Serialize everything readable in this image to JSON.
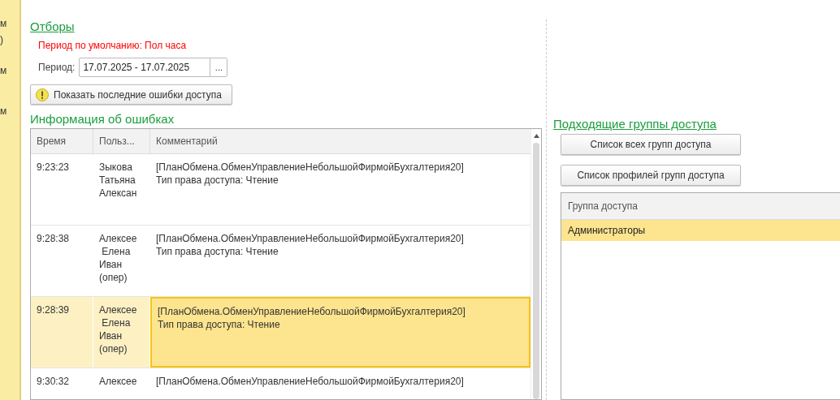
{
  "sidebar": {
    "items": [
      {
        "text": "м"
      },
      {
        "text": ")"
      },
      {
        "text": "м"
      },
      {
        "text": "м"
      }
    ]
  },
  "filters": {
    "title": "Отборы",
    "default_period_note": "Период по умолчанию: Пол часа",
    "period_label": "Период:",
    "period_value": "17.07.2025 - 17.07.2025",
    "period_button": "...",
    "show_errors_button": "Показать последние ошибки доступа"
  },
  "errors": {
    "title": "Информация об ошибках",
    "columns": [
      "Время",
      "Польз...",
      "Комментарий"
    ],
    "rows": [
      {
        "time": "9:23:23",
        "user": [
          "Зыкова",
          "Татьяна",
          "Алексан"
        ],
        "comment": [
          "[ПланОбмена.ОбменУправлениеНебольшойФирмойБухгалтерия20]",
          "Тип права доступа: Чтение"
        ],
        "selected": false
      },
      {
        "time": "9:28:38",
        "user": [
          "Алексее",
          " Елена",
          "Иван",
          "(опер)"
        ],
        "comment": [
          "[ПланОбмена.ОбменУправлениеНебольшойФирмойБухгалтерия20]",
          "Тип права доступа: Чтение"
        ],
        "selected": false
      },
      {
        "time": "9:28:39",
        "user": [
          "Алексее",
          " Елена",
          "Иван",
          "(опер)"
        ],
        "comment": [
          "[ПланОбмена.ОбменУправлениеНебольшойФирмойБухгалтерия20]",
          "Тип права доступа: Чтение"
        ],
        "selected": true
      },
      {
        "time": "9:30:32",
        "user": [
          "Алексее"
        ],
        "comment": [
          "[ПланОбмена.ОбменУправлениеНебольшойФирмойБухгалтерия20]"
        ],
        "selected": false
      }
    ]
  },
  "groups": {
    "title": "Подходящие группы доступа",
    "buttons": [
      "Список всех групп доступа",
      "Список профилей групп доступа"
    ],
    "column": "Группа доступа",
    "rows": [
      {
        "name": "Администраторы",
        "selected": true
      }
    ]
  }
}
